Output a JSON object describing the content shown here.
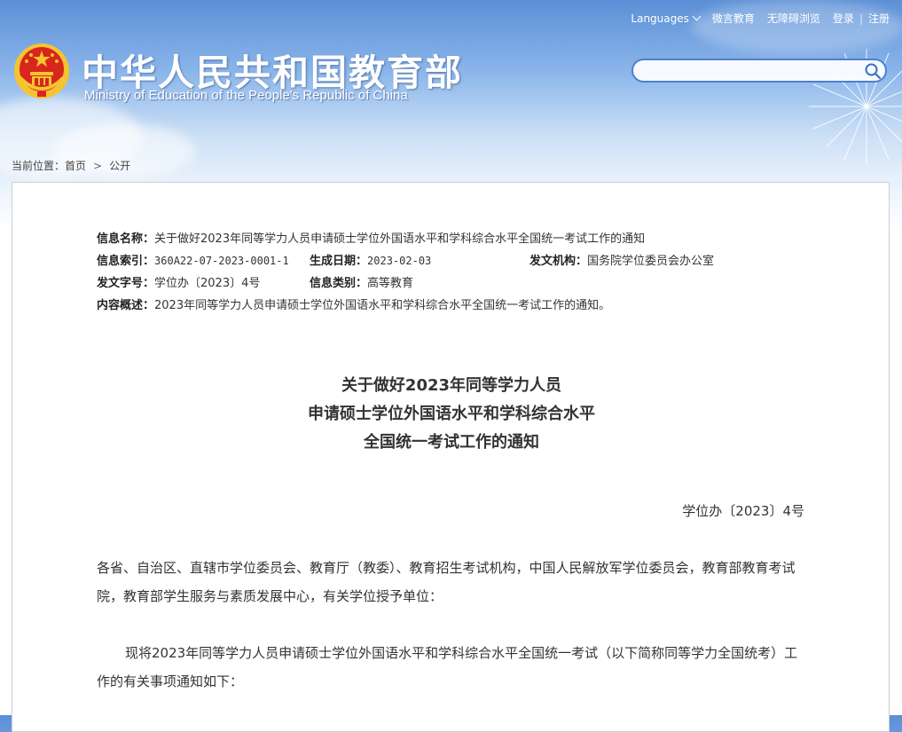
{
  "header": {
    "site_name_cn": "中华人民共和国教育部",
    "site_name_en": "Ministry of Education of the People's Republic of China",
    "topnav": {
      "languages": "Languages",
      "weibo": "微言教育",
      "accessible": "无障碍浏览",
      "login": "登录",
      "register": "注册"
    },
    "search": {
      "placeholder": ""
    }
  },
  "breadcrumb": {
    "prefix": "当前位置：",
    "home": "首页",
    "current": "公开"
  },
  "info": {
    "name_label": "信息名称：",
    "name_value": "关于做好2023年同等学力人员申请硕士学位外国语水平和学科综合水平全国统一考试工作的通知",
    "index_label": "信息索引：",
    "index_value": "360A22-07-2023-0001-1",
    "date_label": "生成日期：",
    "date_value": "2023-02-03",
    "issuer_label": "发文机构：",
    "issuer_value": "国务院学位委员会办公室",
    "docnum_label": "发文字号：",
    "docnum_value": "学位办〔2023〕4号",
    "category_label": "信息类别：",
    "category_value": "高等教育",
    "summary_label": "内容概述：",
    "summary_value": "2023年同等学力人员申请硕士学位外国语水平和学科综合水平全国统一考试工作的通知。"
  },
  "article": {
    "title_line1": "关于做好2023年同等学力人员",
    "title_line2": "申请硕士学位外国语水平和学科综合水平",
    "title_line3": "全国统一考试工作的通知",
    "doc_number": "学位办〔2023〕4号",
    "paragraph1": "各省、自治区、直辖市学位委员会、教育厅（教委）、教育招生考试机构，中国人民解放军学位委员会，教育部教育考试院，教育部学生服务与素质发展中心，有关学位授予单位：",
    "paragraph2": "现将2023年同等学力人员申请硕士学位外国语水平和学科综合水平全国统一考试（以下简称同等学力全国统考）工作的有关事项通知如下："
  },
  "colors": {
    "header_top": "#5b8fd6",
    "search_border": "#4f7fcf",
    "emblem_red": "#d7261e",
    "emblem_gold": "#f5c431"
  },
  "icons": [
    "national-emblem-icon",
    "chevron-down-icon",
    "search-icon",
    "chevron-right-icon"
  ]
}
